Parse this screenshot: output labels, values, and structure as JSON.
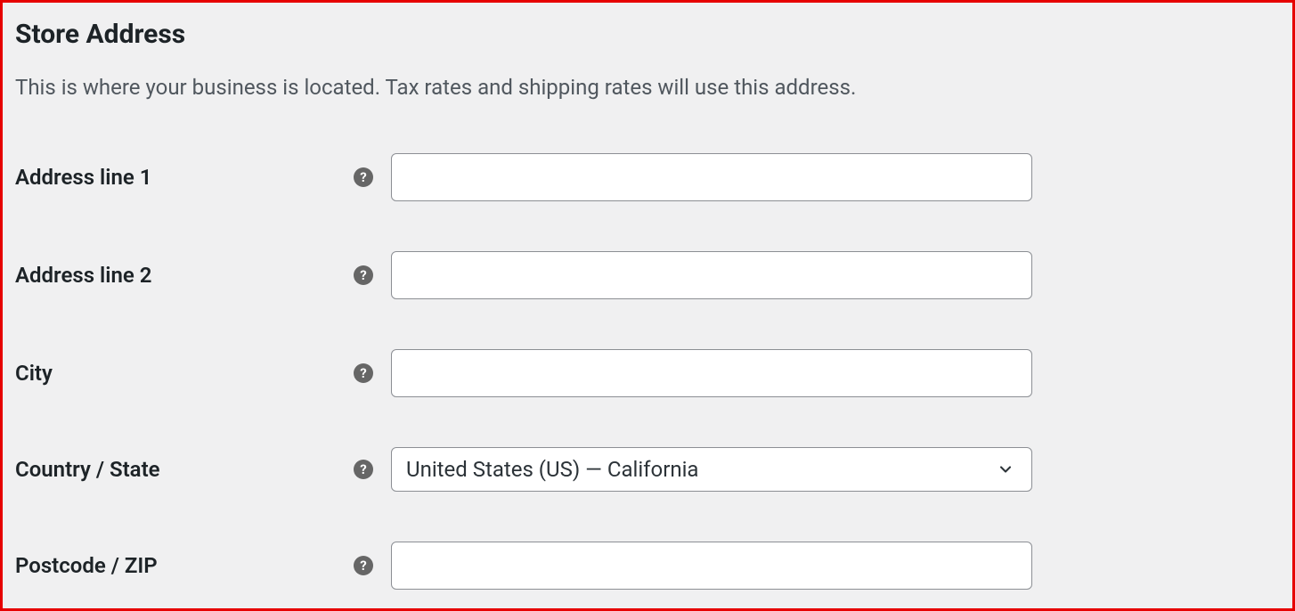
{
  "heading": "Store Address",
  "description": "This is where your business is located. Tax rates and shipping rates will use this address.",
  "fields": {
    "address1": {
      "label": "Address line 1",
      "value": ""
    },
    "address2": {
      "label": "Address line 2",
      "value": ""
    },
    "city": {
      "label": "City",
      "value": ""
    },
    "country_state": {
      "label": "Country / State",
      "selected": "United States (US) — California"
    },
    "postcode": {
      "label": "Postcode / ZIP",
      "value": ""
    }
  }
}
